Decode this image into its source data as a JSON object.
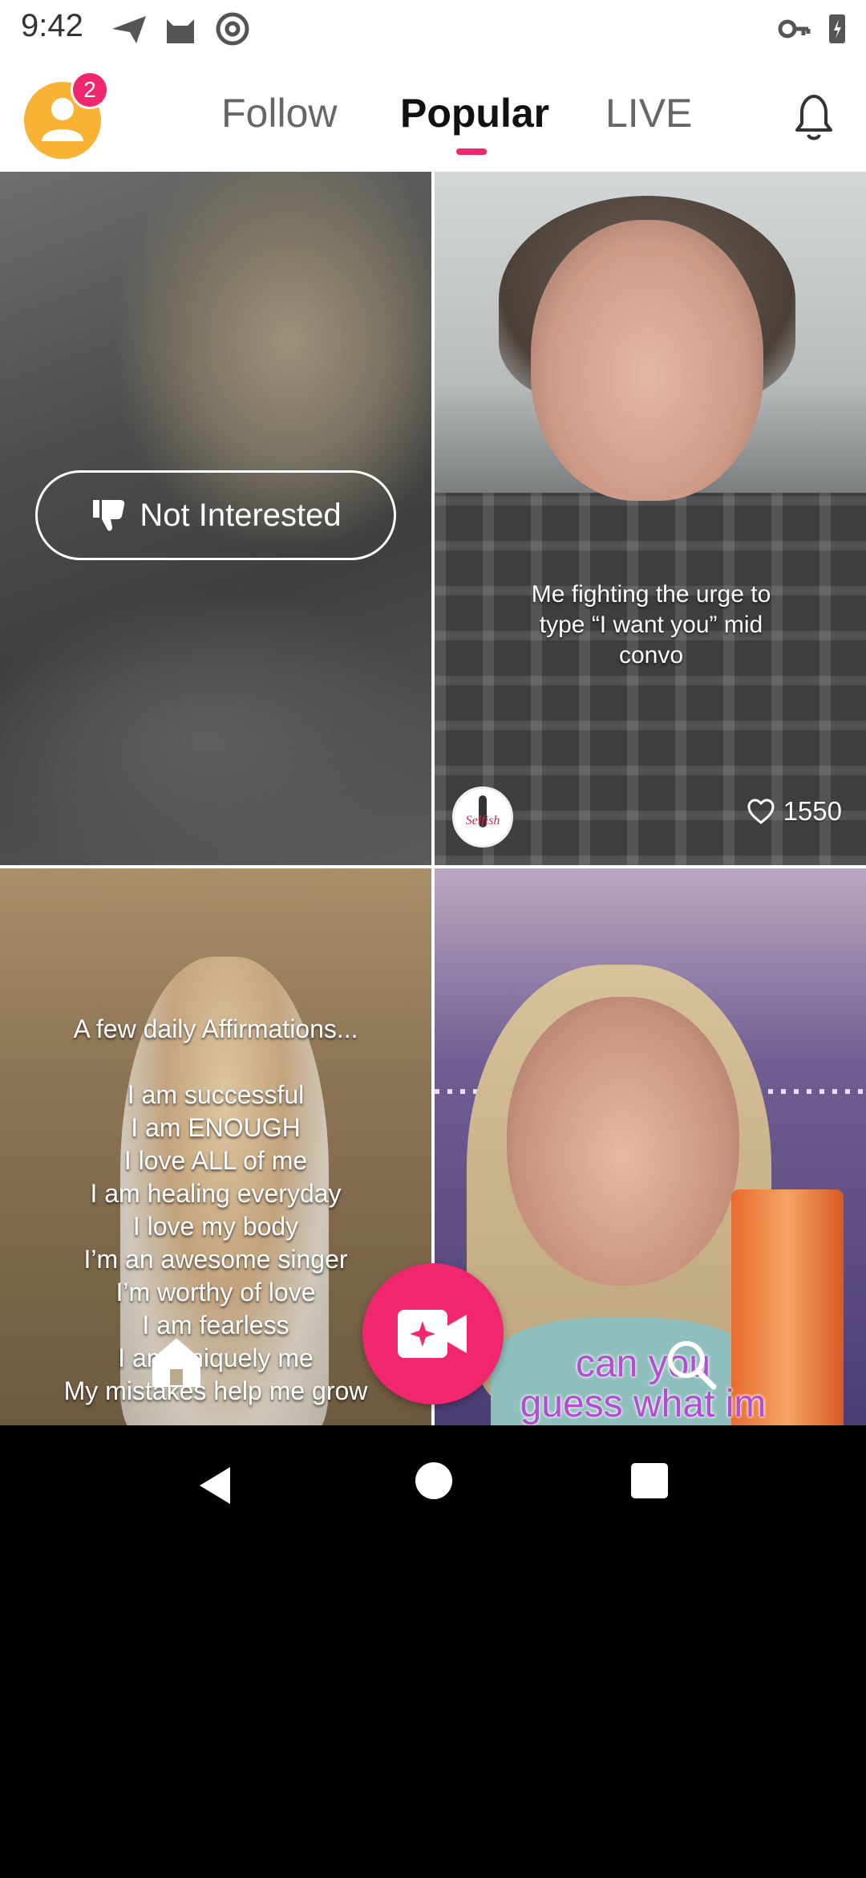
{
  "status_bar": {
    "time": "9:42",
    "left_icons": [
      "send-icon",
      "cat-icon",
      "at-icon"
    ],
    "right_icons": [
      "key-icon",
      "battery-icon"
    ]
  },
  "header": {
    "notification_badge": "2",
    "tabs": [
      {
        "label": "Follow",
        "active": false
      },
      {
        "label": "Popular",
        "active": true
      },
      {
        "label": "LIVE",
        "active": false
      }
    ],
    "accent_color": "#f0266f"
  },
  "feed": {
    "tiles": [
      {
        "id": "tile-1",
        "not_interested_label": "Not Interested"
      },
      {
        "id": "tile-2",
        "caption_lines": [
          "Me fighting the urge to",
          "type “I want you” mid",
          "convo"
        ],
        "likes": "1550",
        "creator_sign": "Selfish"
      },
      {
        "id": "tile-3",
        "caption_lines": [
          "A few daily Affirmations...",
          "",
          "I am successful",
          "I am ENOUGH",
          "I love ALL of me",
          "I am healing everyday",
          "I love my body",
          "I’m an awesome singer",
          "I’m worthy of love",
          "I am fearless",
          "I am uniquely me",
          "My mistakes help me grow"
        ]
      },
      {
        "id": "tile-4",
        "caption_lines": [
          "can you",
          "guess what im"
        ]
      }
    ]
  },
  "bottom_nav": {
    "items": [
      "home-icon",
      "video-camera-icon",
      "search-icon"
    ]
  }
}
